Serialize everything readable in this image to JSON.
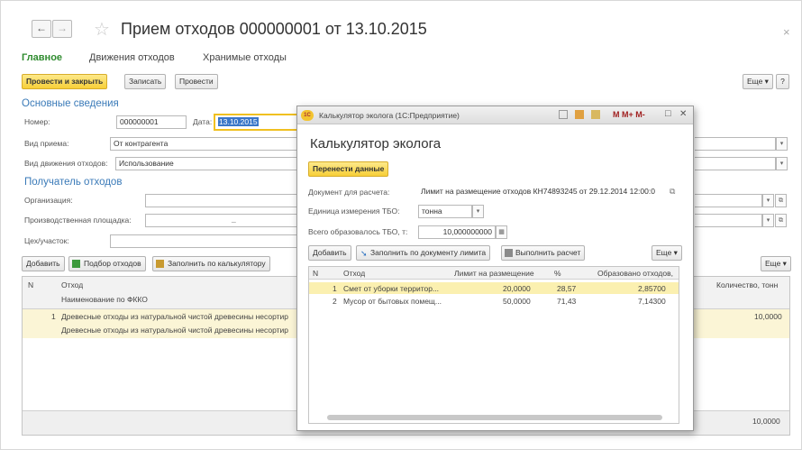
{
  "window": {
    "title": "Прием отходов 000000001 от 13.10.2015",
    "back": "←",
    "forward": "→",
    "star": "☆",
    "close": "×"
  },
  "tabs": [
    "Главное",
    "Движения отходов",
    "Хранимые отходы"
  ],
  "toolbar": {
    "post_close": "Провести и закрыть",
    "write": "Записать",
    "post": "Провести",
    "more": "Еще ▾",
    "help": "?"
  },
  "basic": {
    "section": "Основные сведения",
    "number_label": "Номер:",
    "number": "000000001",
    "date_label": "Дата:",
    "date": "13.10.2015",
    "receipt_type_label": "Вид приема:",
    "receipt_type": "От контрагента",
    "movement_type_label": "Вид движения отходов:",
    "movement_type": "Использование"
  },
  "recipient": {
    "section": "Получатель отходов",
    "org_label": "Организация:",
    "site_label": "Производственная площадка:",
    "site_dash": "_",
    "shop_label": "Цех/участок:"
  },
  "table_toolbar": {
    "add": "Добавить",
    "pick": "Подбор отходов",
    "fill_calc": "Заполнить по калькулятору",
    "more": "Еще ▾"
  },
  "table": {
    "col_n": "N",
    "col_waste": "Отход",
    "col_fkko": "Наименование по ФККО",
    "col_qty": "Количество, тонн",
    "rows": [
      {
        "n": "1",
        "waste": "Древесные отходы из натуральной чистой древесины несортир",
        "fkko": "Древесные отходы из натуральной чистой древесины несортир",
        "qty": "10,0000"
      }
    ],
    "total": "10,0000"
  },
  "dialog": {
    "window_title": "Калькулятор эколога (1С:Предприятие)",
    "logo": "1С",
    "header_icons": "M M+ M-",
    "minmax": "□",
    "close": "✕",
    "heading": "Калькулятор эколога",
    "transfer": "Перенести данные",
    "doc_label": "Документ для расчета:",
    "doc_value": "Лимит на размещение отходов КН74893245 от 29.12.2014 12:00:0",
    "unit_label": "Единица измерения ТБО:",
    "unit_value": "тонна",
    "total_label": "Всего образовалось ТБО, т:",
    "total_value": "10,000000000",
    "add": "Добавить",
    "fill_limit": "Заполнить по документу лимита",
    "calc": "Выполнить расчет",
    "more": "Еще ▾",
    "col_n": "N",
    "col_waste": "Отход",
    "col_limit": "Лимит на размещение",
    "col_pct": "%",
    "col_formed": "Образовано отходов,",
    "rows": [
      {
        "n": "1",
        "waste": "Смет от уборки территор...",
        "limit": "20,0000",
        "pct": "28,57",
        "formed": "2,85700"
      },
      {
        "n": "2",
        "waste": "Мусор от бытовых помещ...",
        "limit": "50,0000",
        "pct": "71,43",
        "formed": "7,14300"
      }
    ]
  }
}
